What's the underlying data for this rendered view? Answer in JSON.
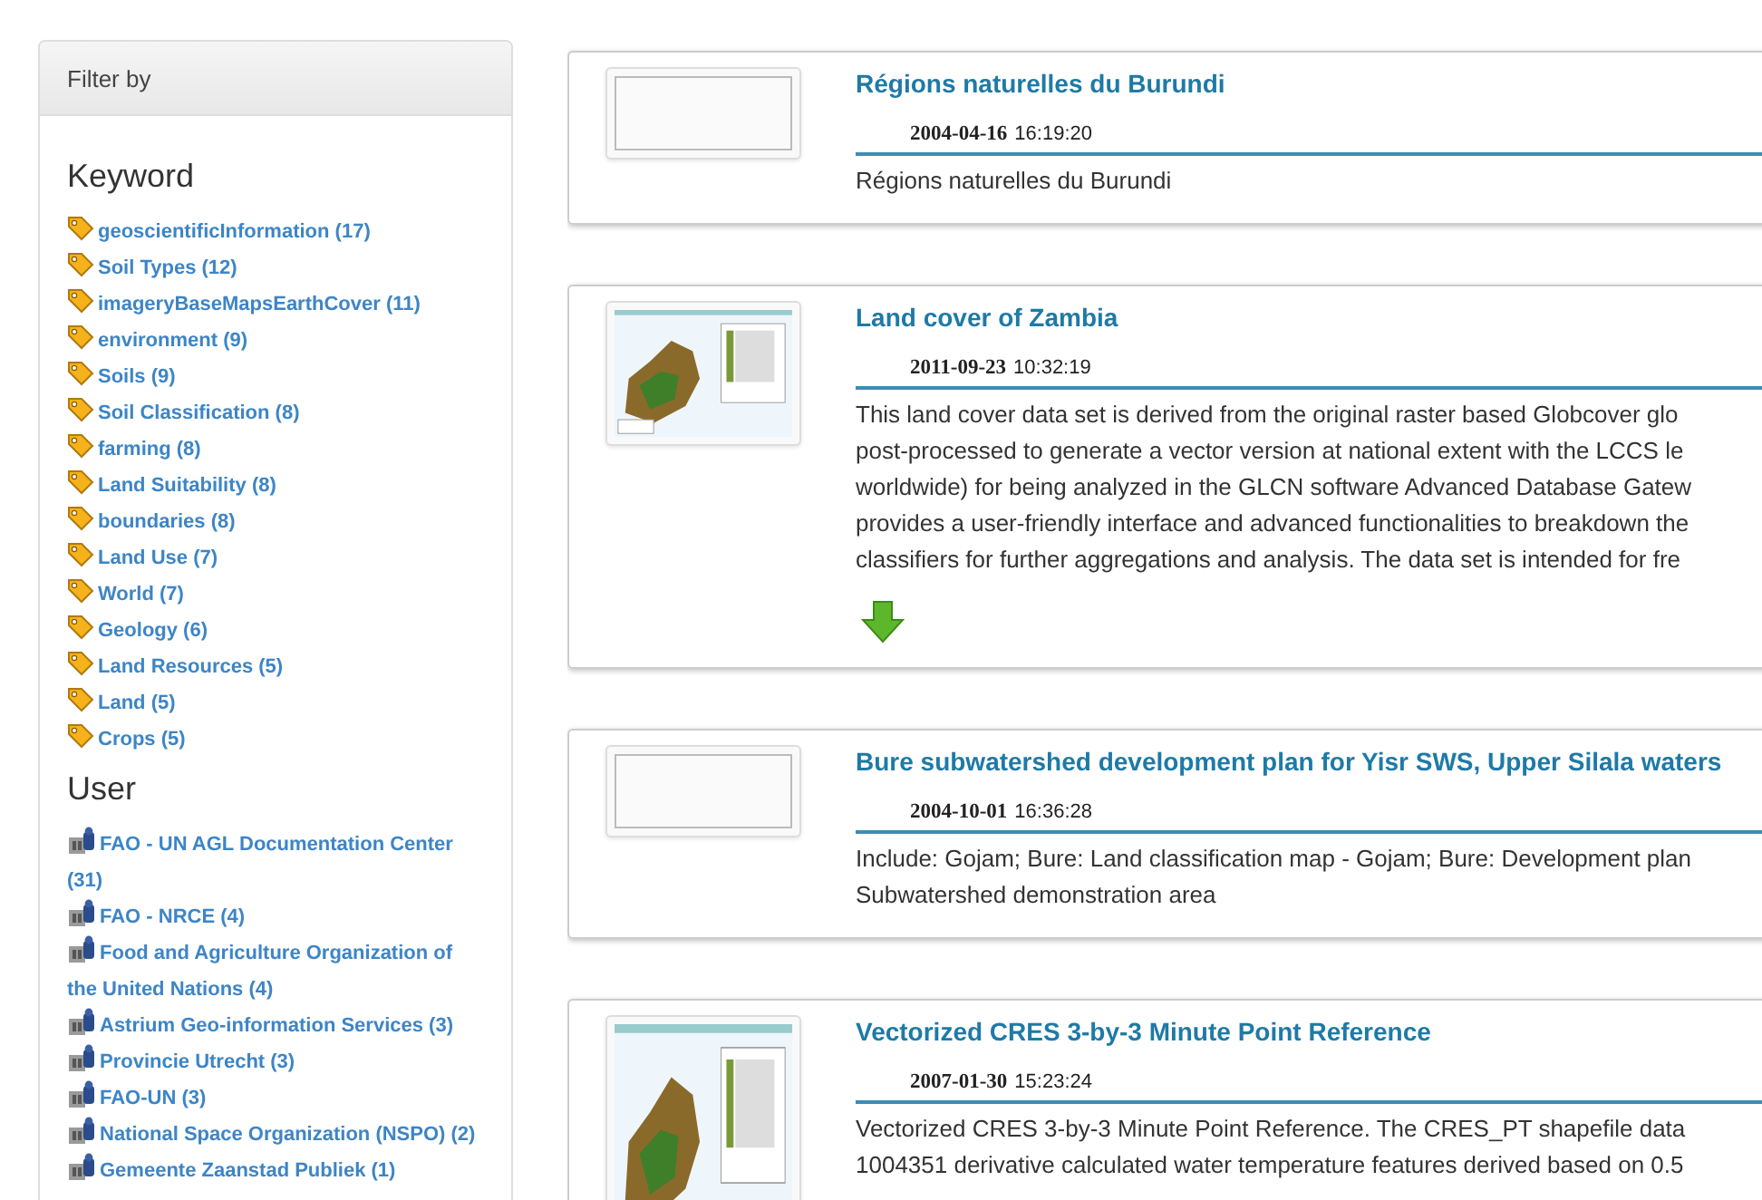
{
  "filter": {
    "title": "Filter by",
    "sections": [
      {
        "heading": "Keyword",
        "kind": "keyword",
        "items": [
          {
            "label": "geoscientificInformation (17)"
          },
          {
            "label": "Soil Types (12)"
          },
          {
            "label": "imageryBaseMapsEarthCover (11)"
          },
          {
            "label": "environment (9)"
          },
          {
            "label": "Soils (9)"
          },
          {
            "label": "Soil Classification (8)"
          },
          {
            "label": "farming (8)"
          },
          {
            "label": "Land Suitability (8)"
          },
          {
            "label": "boundaries (8)"
          },
          {
            "label": "Land Use (7)"
          },
          {
            "label": "World (7)"
          },
          {
            "label": "Geology (6)"
          },
          {
            "label": "Land Resources (5)"
          },
          {
            "label": "Land (5)"
          },
          {
            "label": "Crops (5)"
          }
        ]
      },
      {
        "heading": "User",
        "kind": "user",
        "items": [
          {
            "label": "FAO - UN AGL Documentation Center (31)"
          },
          {
            "label": "FAO - NRCE (4)"
          },
          {
            "label": "Food and Agriculture Organization of the United Nations (4)"
          },
          {
            "label": "Astrium Geo-information Services (3)"
          },
          {
            "label": "Provincie Utrecht (3)"
          },
          {
            "label": "FAO-UN (3)"
          },
          {
            "label": "National Space Organization (NSPO) (2)"
          },
          {
            "label": "Gemeente Zaanstad Publiek (1)"
          }
        ]
      }
    ]
  },
  "results": [
    {
      "title": "Régions naturelles du Burundi",
      "date": "2004-04-16",
      "time": "16:19:20",
      "thumbnail": {
        "kind": "blank"
      },
      "download": false,
      "description": [
        "Régions naturelles du Burundi"
      ]
    },
    {
      "title": "Land cover of Zambia",
      "date": "2011-09-23",
      "time": "10:32:19",
      "download": true,
      "description": [
        "This land cover data set is derived from the original raster based Globcover glo",
        "post-processed to generate a vector version at national extent with the LCCS le",
        "worldwide) for being analyzed in the GLCN software Advanced Database Gatew",
        "provides a user-friendly interface and advanced functionalities to breakdown the",
        "classifiers for further aggregations and analysis. The data set is intended for fre"
      ]
    },
    {
      "title": "Bure subwatershed development plan for Yisr SWS, Upper Silala waters",
      "date": "2004-10-01",
      "time": "16:36:28",
      "thumbnail": {
        "kind": "blank"
      },
      "download": false,
      "description": [
        "Include: Gojam; Bure: Land classification map - Gojam; Bure: Development plan",
        "Subwatershed demonstration area"
      ]
    },
    {
      "title": "Vectorized CRES 3-by-3 Minute Point Reference",
      "date": "2007-01-30",
      "time": "15:23:24",
      "download": false,
      "description": [
        "Vectorized CRES 3-by-3 Minute Point Reference. The CRES_PT shapefile data",
        "1004351 derivative calculated water temperature features derived based on 0.5"
      ]
    }
  ]
}
